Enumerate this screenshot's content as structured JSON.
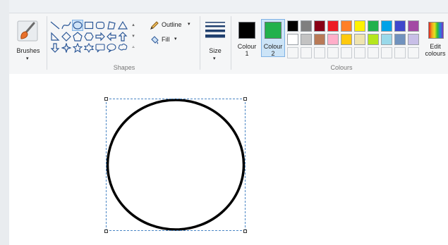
{
  "ribbon": {
    "brushes": {
      "label": "Brushes",
      "icon": "paintbrush-icon"
    },
    "shapes": {
      "group_label": "Shapes",
      "outline_label": "Outline",
      "fill_label": "Fill",
      "items": [
        "line",
        "curve",
        "oval",
        "rectangle",
        "rounded-rectangle",
        "polygon",
        "triangle",
        "right-triangle",
        "diamond",
        "pentagon",
        "hexagon",
        "right-arrow",
        "left-arrow",
        "up-arrow",
        "down-arrow",
        "four-point-star",
        "five-point-star",
        "six-point-star",
        "rounded-callout",
        "oval-callout",
        "cloud-callout"
      ]
    },
    "size": {
      "label": "Size"
    },
    "colours": {
      "group_label": "Colours",
      "colour1": {
        "label_line1": "Colour",
        "label_line2": "1",
        "color": "#000000"
      },
      "colour2": {
        "label_line1": "Colour",
        "label_line2": "2",
        "color": "#22b14c"
      },
      "edit_line1": "Edit",
      "edit_line2": "colours",
      "palette_row1": [
        "#000000",
        "#7f7f7f",
        "#880015",
        "#ed1c24",
        "#ff7f27",
        "#fff200",
        "#22b14c",
        "#00a2e8",
        "#3f48cc",
        "#a349a4"
      ],
      "palette_row2": [
        "#ffffff",
        "#c3c3c3",
        "#b97a57",
        "#ffaec9",
        "#ffc90e",
        "#efe4b0",
        "#b5e61d",
        "#99d9ea",
        "#7092be",
        "#c8bfe7"
      ]
    }
  },
  "canvas": {
    "background": "#ffffff",
    "shape": "oval",
    "stroke": "#000000"
  }
}
